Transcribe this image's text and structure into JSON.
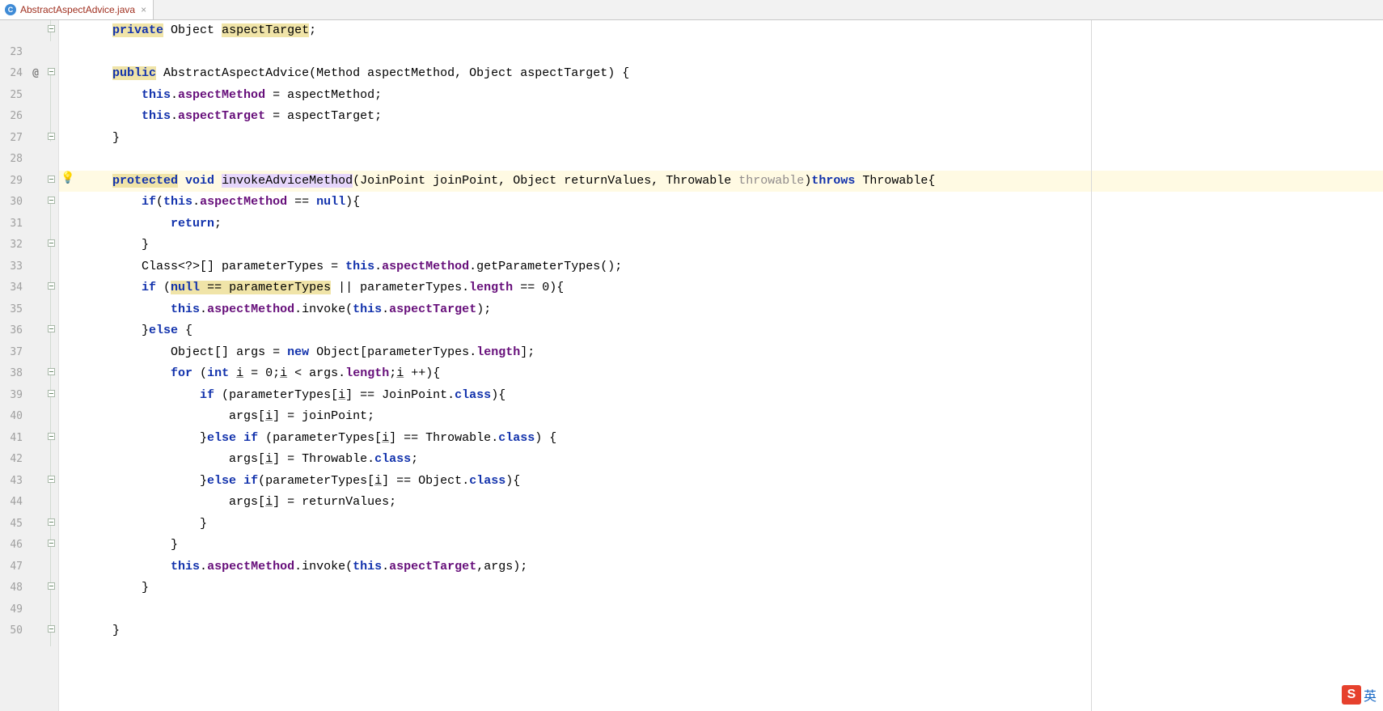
{
  "tab": {
    "filename": "AbstractAspectAdvice.java",
    "icon_letter": "C"
  },
  "gutter": {
    "line_numbers": [
      "",
      "23",
      "24",
      "25",
      "26",
      "27",
      "28",
      "29",
      "30",
      "31",
      "32",
      "33",
      "34",
      "35",
      "36",
      "37",
      "38",
      "39",
      "40",
      "41",
      "42",
      "43",
      "44",
      "45",
      "46",
      "47",
      "48",
      "49",
      "50"
    ],
    "highlighted_line_number": "29",
    "override_at_line": "24",
    "bulb_at_line": "29",
    "fold_toggle_lines": [
      "22",
      "24",
      "27",
      "29",
      "30",
      "32",
      "34",
      "36",
      "38",
      "39",
      "41",
      "43",
      "45",
      "46",
      "48",
      "50"
    ]
  },
  "ime": {
    "logo": "S",
    "lang": "英"
  },
  "tokens": {
    "kw_private": "private",
    "kw_public": "public",
    "kw_this": "this",
    "kw_protected": "protected",
    "kw_void": "void",
    "kw_throws": "throws",
    "kw_if": "if",
    "kw_null": "null",
    "kw_return": "return",
    "kw_else": "else",
    "kw_new": "new",
    "kw_for": "for",
    "kw_int": "int",
    "kw_class": "class",
    "type_object": "Object",
    "type_method": "Method",
    "type_joinpoint": "JoinPoint",
    "type_throwable": "Throwable",
    "type_class_generic": "Class<?>[]",
    "id_aspectTarget": "aspectTarget",
    "id_aspectMethod": "aspectMethod",
    "id_joinPoint": "joinPoint",
    "id_returnValues": "returnValues",
    "id_throwable": "throwable",
    "id_parameterTypes": "parameterTypes",
    "id_args": "args",
    "id_i": "i",
    "id_length": "length",
    "m_invoke": "invoke",
    "m_getParameterTypes": "getParameterTypes",
    "m_invokeAdviceMethod": "invokeAdviceMethod",
    "ctor_name": "AbstractAspectAdvice"
  }
}
